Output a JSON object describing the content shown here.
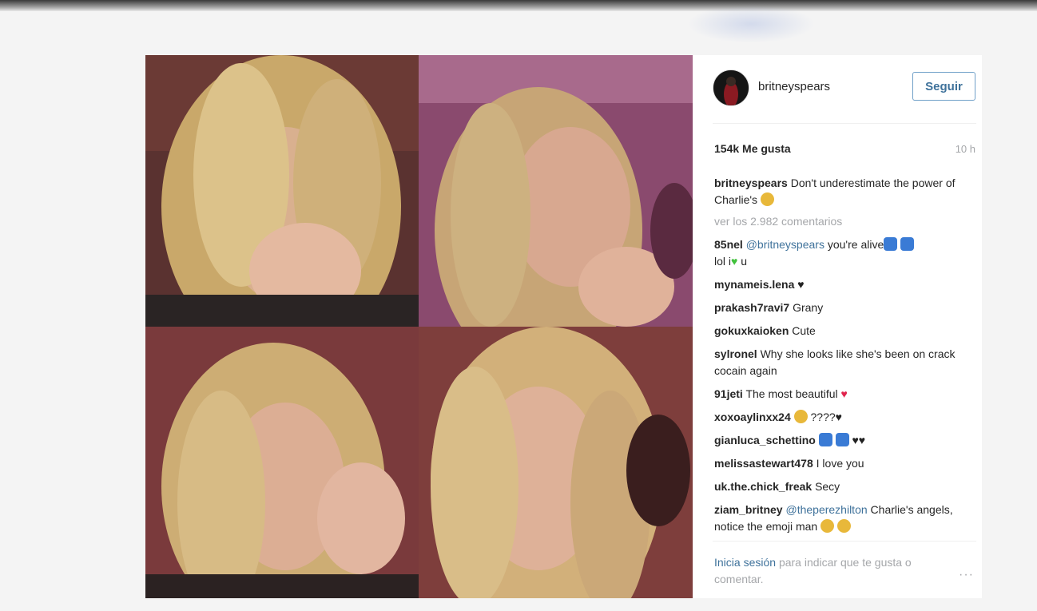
{
  "post": {
    "username": "britneyspears",
    "follow_label": "Seguir",
    "likes": "154k Me gusta",
    "time": "10 h",
    "caption": {
      "author": "britneyspears",
      "text": "Don't underestimate the power of Charlie's"
    },
    "view_all_comments": "ver los 2.982 comentarios",
    "comments": [
      {
        "author": "85nel",
        "mention": "@britneyspears",
        "text": "you're alive",
        "tail": "lol i",
        "tail2": "u"
      },
      {
        "author": "mynameis.lena",
        "text": ""
      },
      {
        "author": "prakash7ravi7",
        "text": "Grany"
      },
      {
        "author": "gokuxkaioken",
        "text": "Cute"
      },
      {
        "author": "sylronel",
        "text": "Why she looks like she's been on crack cocain again"
      },
      {
        "author": "91jeti",
        "text": "The most beautiful"
      },
      {
        "author": "xoxoaylinxx24",
        "text": "????"
      },
      {
        "author": "gianluca_schettino",
        "text": ""
      },
      {
        "author": "melissastewart478",
        "text": "I love you"
      },
      {
        "author": "uk.the.chick_freak",
        "text": "Secy"
      },
      {
        "author": "ziam_britney",
        "mention": "@theperezhilton",
        "text": "Charlie's angels, notice the emoji man"
      }
    ],
    "footer": {
      "login_link": "Inicia sesión",
      "login_text": "para indicar que te gusta o comentar."
    },
    "more_label": "···"
  },
  "colors": {
    "link": "#3f729b",
    "muted": "#a5a7aa",
    "heart_red": "#e0244d",
    "heart_green": "#41c13c",
    "emoji_yellow": "#e8b83a",
    "emoji_blue": "#3a7bd5"
  },
  "icons": {
    "more": "ellipsis-icon",
    "emoji_face": "smiley-face-icon",
    "heart": "heart-icon"
  }
}
